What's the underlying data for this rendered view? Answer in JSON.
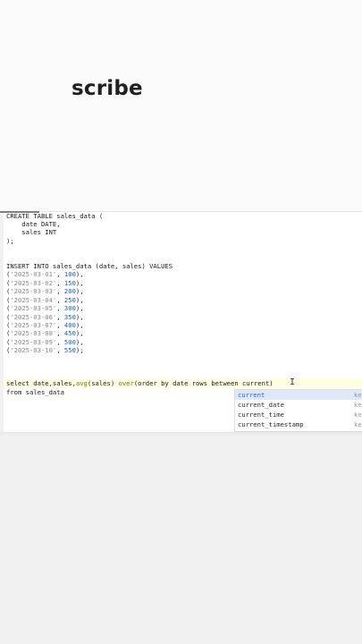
{
  "branding": {
    "watermark": "scribe"
  },
  "editor": {
    "code": {
      "create_table": "CREATE TABLE sales_data (",
      "col_date": "    date DATE,",
      "col_sales": "    sales INT",
      "close_paren": ");",
      "insert": "INSERT INTO sales_data (date, sales) VALUES",
      "rows": [
        {
          "date": "'2025-03-01'",
          "value": "100"
        },
        {
          "date": "'2025-03-02'",
          "value": "150"
        },
        {
          "date": "'2025-03-03'",
          "value": "200"
        },
        {
          "date": "'2025-03-04'",
          "value": "250"
        },
        {
          "date": "'2025-03-05'",
          "value": "300"
        },
        {
          "date": "'2025-03-06'",
          "value": "350"
        },
        {
          "date": "'2025-03-07'",
          "value": "400"
        },
        {
          "date": "'2025-03-08'",
          "value": "450"
        },
        {
          "date": "'2025-03-09'",
          "value": "500"
        },
        {
          "date": "'2025-03-10'",
          "value": "550"
        }
      ],
      "row_terminators": [
        ",",
        ",",
        ",",
        ",",
        ",",
        ",",
        ",",
        ",",
        ",",
        ";"
      ],
      "select_prefix": "select date,sales,",
      "select_fn": "avg",
      "select_mid": "(sales) ",
      "select_over": "over",
      "select_suffix": "(order by date rows between current)",
      "from_line": "from sales_data"
    },
    "autocomplete": {
      "items": [
        {
          "label": "current",
          "kind": "ke"
        },
        {
          "label": "current_date",
          "kind": "ke"
        },
        {
          "label": "current_time",
          "kind": "ke"
        },
        {
          "label": "current_timestamp",
          "kind": "ke"
        }
      ],
      "selected_index": 0
    }
  },
  "colors": {
    "accent_blue": "#2e63c6",
    "number_blue": "#1c5fb3",
    "function_olive": "#6f7d1c",
    "selection_bg": "#dde8f8",
    "current_line_bg": "#fffde3"
  }
}
